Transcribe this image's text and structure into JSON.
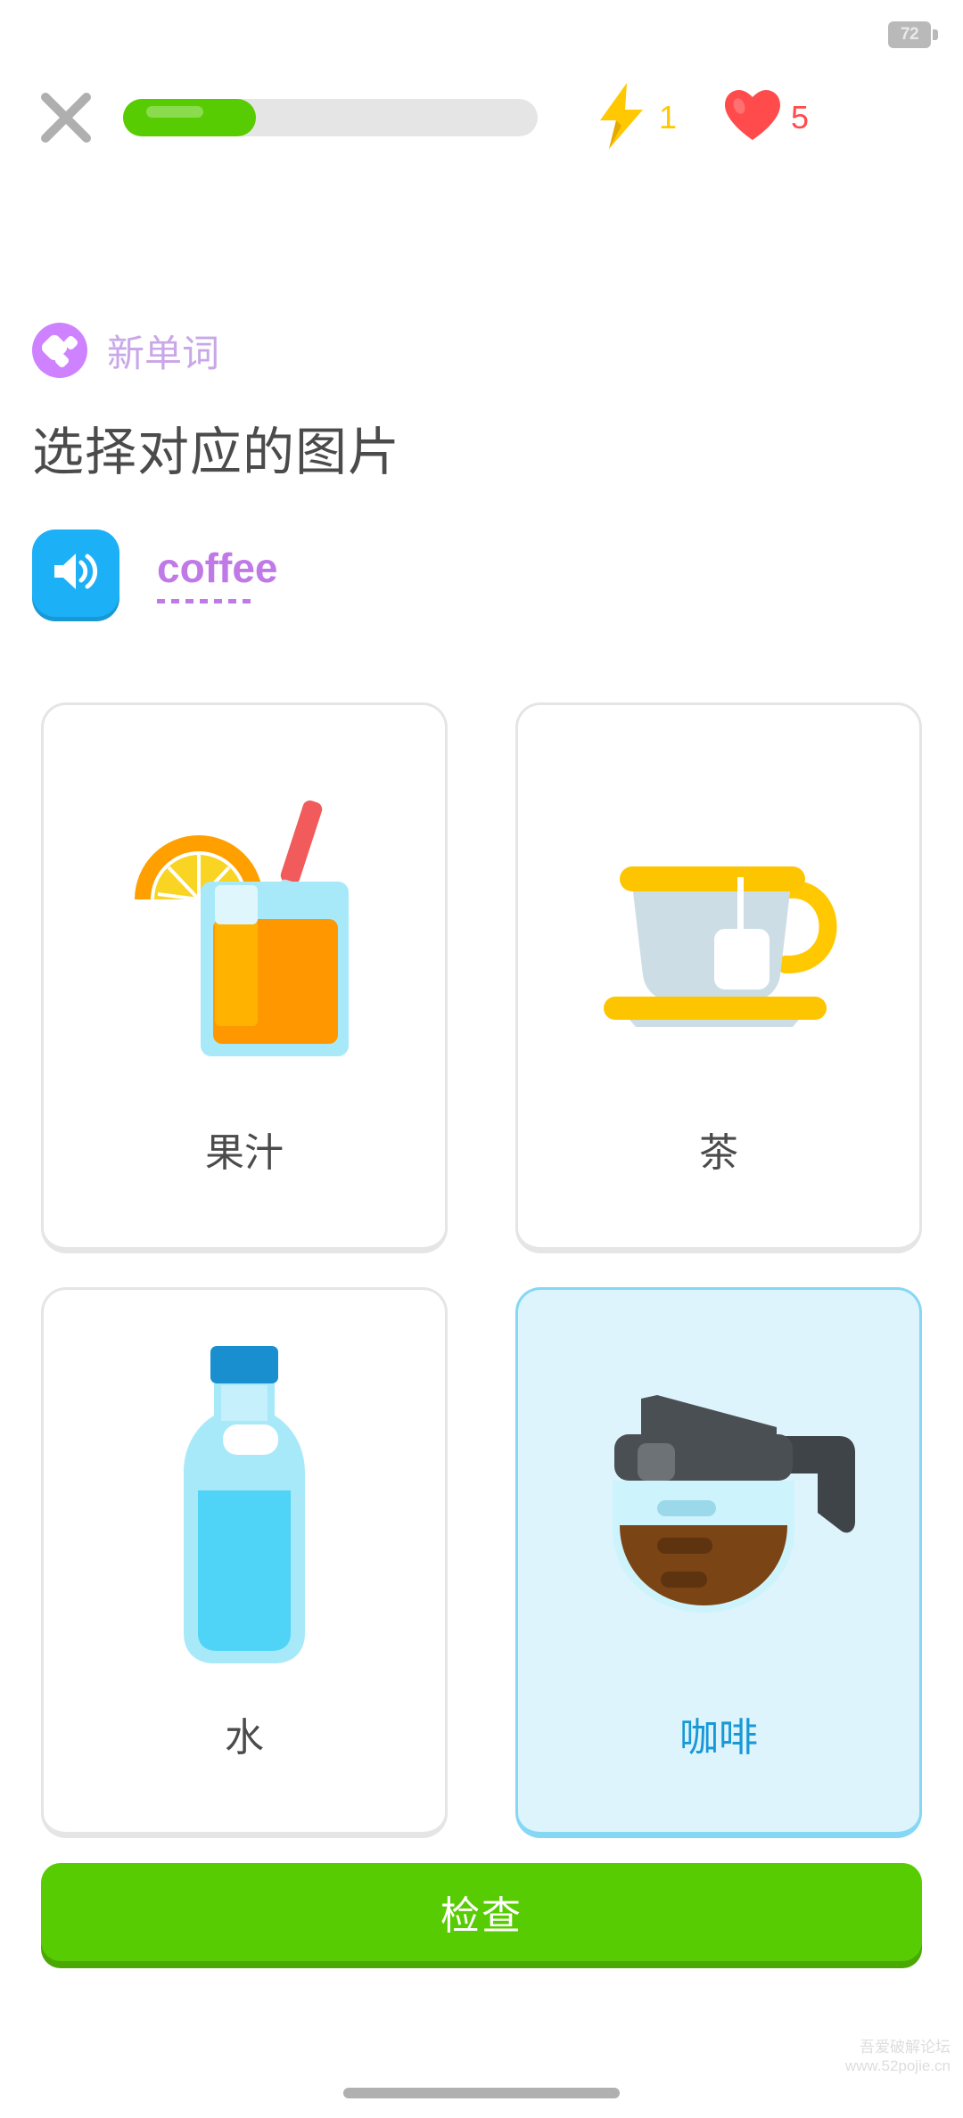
{
  "statusbar": {
    "battery_level": "72"
  },
  "header": {
    "close_icon": "close-icon",
    "progress_percent": 32,
    "streak": {
      "icon": "lightning-bolt-icon",
      "value": "1"
    },
    "hearts": {
      "icon": "heart-icon",
      "value": "5"
    }
  },
  "lesson": {
    "badge_icon": "new-word-icon",
    "badge_label": "新单词",
    "prompt_title": "选择对应的图片",
    "audio_icon": "speaker-icon",
    "word": "coffee"
  },
  "answers": [
    {
      "id": "juice",
      "label": "果汁",
      "art": "juice-glass-illustration",
      "selected": false
    },
    {
      "id": "tea",
      "label": "茶",
      "art": "tea-cup-illustration",
      "selected": false
    },
    {
      "id": "water",
      "label": "水",
      "art": "water-bottle-illustration",
      "selected": false
    },
    {
      "id": "coffee",
      "label": "咖啡",
      "art": "coffee-pot-illustration",
      "selected": true
    }
  ],
  "footer": {
    "check_label": "检查"
  },
  "watermark": {
    "line1": "吾爱破解论坛",
    "line2": "www.52pojie.cn"
  },
  "colors": {
    "green": "#58cc02",
    "green_shadow": "#4aa802",
    "blue": "#1cb0f6",
    "purple": "#ce82ff",
    "purple_text": "#c07ae8",
    "badge_text": "#c9a7e8",
    "heart_red": "#ff4b4b",
    "bolt_yellow": "#ffc800",
    "card_border": "#e5e5e5",
    "selected_bg": "#ddf4fd",
    "selected_border": "#84d8f4",
    "selected_text": "#1899d6",
    "text_dark": "#4b4b4b"
  }
}
